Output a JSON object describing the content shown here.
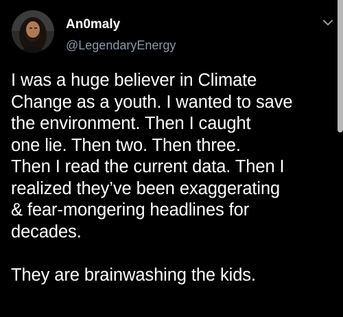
{
  "tweet": {
    "display_name": "An0maly",
    "handle": "@LegendaryEnergy",
    "avatar_icon": "profile-photo",
    "menu_icon": "chevron-down-icon",
    "body_lines": [
      "I was a huge believer in Climate",
      "Change as a youth. I wanted to save",
      "the environment. Then I caught",
      "one lie. Then two. Then three.",
      "Then I read the current data. Then I",
      "realized they’ve been exaggerating",
      "& fear-mongering headlines for",
      "decades."
    ],
    "closing_line": "They are brainwashing the kids."
  },
  "colors": {
    "background": "#000000",
    "text": "#ffffff",
    "secondary_text": "#8b98a5"
  }
}
